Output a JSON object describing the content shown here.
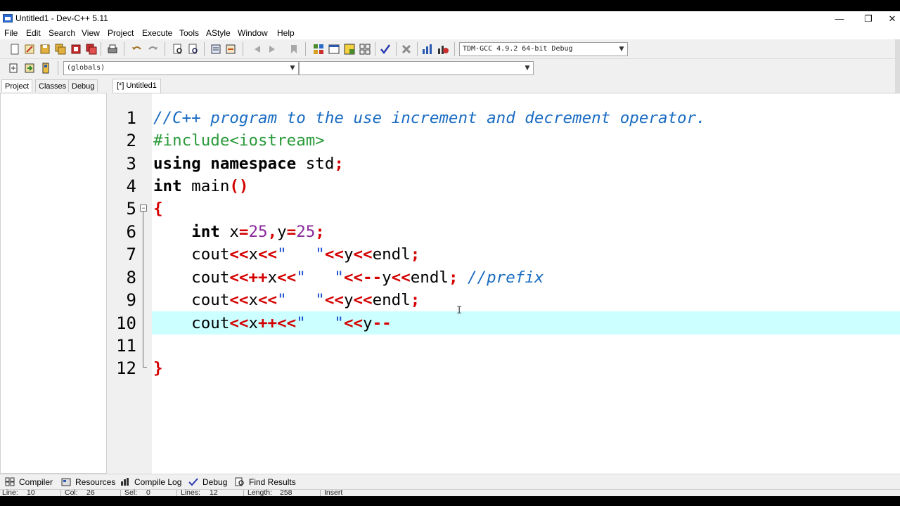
{
  "window": {
    "title": "Untitled1 - Dev-C++ 5.11",
    "minimize": "—",
    "restore": "❐",
    "close": "✕"
  },
  "menu": [
    "File",
    "Edit",
    "Search",
    "View",
    "Project",
    "Execute",
    "Tools",
    "AStyle",
    "Window",
    "Help"
  ],
  "toolbar": {
    "compiler_select": "TDM-GCC 4.9.2 64-bit Debug",
    "scope_select": "(globals)",
    "member_select": ""
  },
  "left_tabs": [
    "Project",
    "Classes",
    "Debug"
  ],
  "editor_tab": "[*] Untitled1",
  "code_lines": [
    {
      "n": "1",
      "tokens": [
        {
          "t": "//C++ program to the use increment and decrement operator.",
          "c": "comment"
        }
      ]
    },
    {
      "n": "2",
      "tokens": [
        {
          "t": "#include<iostream>",
          "c": "pre"
        }
      ]
    },
    {
      "n": "3",
      "tokens": [
        {
          "t": "using",
          "c": "kw"
        },
        {
          "t": " ",
          "c": "id"
        },
        {
          "t": "namespace",
          "c": "kw"
        },
        {
          "t": " std",
          "c": "id"
        },
        {
          "t": ";",
          "c": "op"
        }
      ]
    },
    {
      "n": "4",
      "tokens": [
        {
          "t": "int",
          "c": "kw"
        },
        {
          "t": " main",
          "c": "id"
        },
        {
          "t": "()",
          "c": "op"
        }
      ]
    },
    {
      "n": "5",
      "tokens": [
        {
          "t": "{",
          "c": "op"
        }
      ]
    },
    {
      "n": "6",
      "tokens": [
        {
          "t": "    ",
          "c": "id"
        },
        {
          "t": "int",
          "c": "kw"
        },
        {
          "t": " x",
          "c": "id"
        },
        {
          "t": "=",
          "c": "op"
        },
        {
          "t": "25",
          "c": "num"
        },
        {
          "t": ",",
          "c": "op"
        },
        {
          "t": "y",
          "c": "id"
        },
        {
          "t": "=",
          "c": "op"
        },
        {
          "t": "25",
          "c": "num"
        },
        {
          "t": ";",
          "c": "op"
        }
      ]
    },
    {
      "n": "7",
      "tokens": [
        {
          "t": "    cout",
          "c": "id"
        },
        {
          "t": "<<",
          "c": "op"
        },
        {
          "t": "x",
          "c": "id"
        },
        {
          "t": "<<",
          "c": "op"
        },
        {
          "t": "\"   \"",
          "c": "str"
        },
        {
          "t": "<<",
          "c": "op"
        },
        {
          "t": "y",
          "c": "id"
        },
        {
          "t": "<<",
          "c": "op"
        },
        {
          "t": "endl",
          "c": "id"
        },
        {
          "t": ";",
          "c": "op"
        }
      ]
    },
    {
      "n": "8",
      "tokens": [
        {
          "t": "    cout",
          "c": "id"
        },
        {
          "t": "<<++",
          "c": "op"
        },
        {
          "t": "x",
          "c": "id"
        },
        {
          "t": "<<",
          "c": "op"
        },
        {
          "t": "\"   \"",
          "c": "str"
        },
        {
          "t": "<<--",
          "c": "op"
        },
        {
          "t": "y",
          "c": "id"
        },
        {
          "t": "<<",
          "c": "op"
        },
        {
          "t": "endl",
          "c": "id"
        },
        {
          "t": ";",
          "c": "op"
        },
        {
          "t": " ",
          "c": "id"
        },
        {
          "t": "//prefix",
          "c": "comment"
        }
      ]
    },
    {
      "n": "9",
      "tokens": [
        {
          "t": "    cout",
          "c": "id"
        },
        {
          "t": "<<",
          "c": "op"
        },
        {
          "t": "x",
          "c": "id"
        },
        {
          "t": "<<",
          "c": "op"
        },
        {
          "t": "\"   \"",
          "c": "str"
        },
        {
          "t": "<<",
          "c": "op"
        },
        {
          "t": "y",
          "c": "id"
        },
        {
          "t": "<<",
          "c": "op"
        },
        {
          "t": "endl",
          "c": "id"
        },
        {
          "t": ";",
          "c": "op"
        }
      ]
    },
    {
      "n": "10",
      "tokens": [
        {
          "t": "    cout",
          "c": "id"
        },
        {
          "t": "<<",
          "c": "op"
        },
        {
          "t": "x",
          "c": "id"
        },
        {
          "t": "++<<",
          "c": "op"
        },
        {
          "t": "\"   \"",
          "c": "str"
        },
        {
          "t": "<<",
          "c": "op"
        },
        {
          "t": "y",
          "c": "id"
        },
        {
          "t": "--",
          "c": "op"
        }
      ]
    },
    {
      "n": "11",
      "tokens": []
    },
    {
      "n": "12",
      "tokens": [
        {
          "t": "}",
          "c": "op"
        }
      ]
    }
  ],
  "bottom_tabs": [
    "Compiler",
    "Resources",
    "Compile Log",
    "Debug",
    "Find Results"
  ],
  "status": {
    "line_label": "Line:",
    "line_value": "10",
    "col_label": "Col:",
    "col_value": "26",
    "sel_label": "Sel:",
    "sel_value": "0",
    "lines_label": "Lines:",
    "lines_value": "12",
    "length_label": "Length:",
    "length_value": "258",
    "mode": "Insert"
  },
  "colors": {
    "comment": "#1a6cc2",
    "preprocessor": "#2a9a3a",
    "operator": "#d40000",
    "number": "#8a2a9a",
    "string": "#1a4fd0",
    "current_line": "#ccffff"
  }
}
